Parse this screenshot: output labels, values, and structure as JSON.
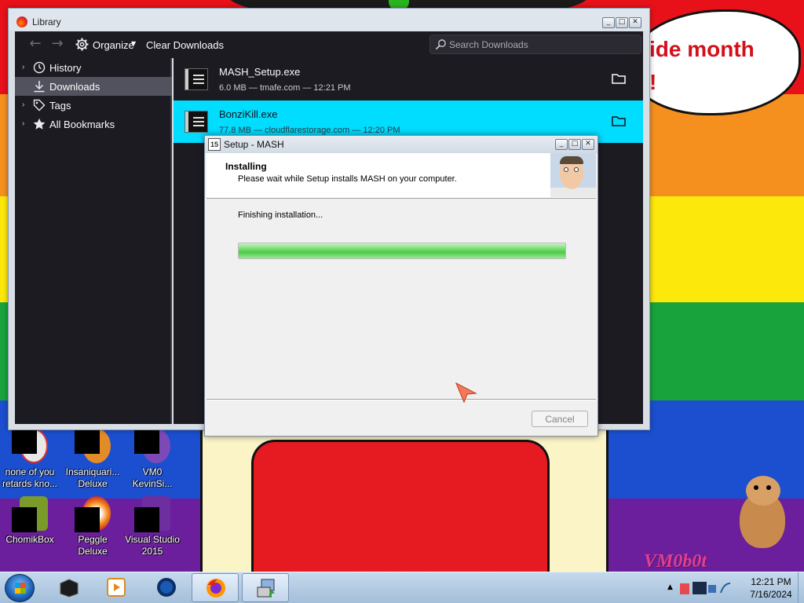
{
  "desktop": {
    "speech_bubble": [
      "ide month",
      "!"
    ],
    "watermark": "VM0b0t",
    "icons": [
      {
        "label": "none of you retards kno..."
      },
      {
        "label": "Insaniquari... Deluxe"
      },
      {
        "label": "VM0 KevinSi..."
      },
      {
        "label": "ChomikBox"
      },
      {
        "label": "Peggle Deluxe"
      },
      {
        "label": "Visual Studio 2015"
      }
    ]
  },
  "library": {
    "title": "Library",
    "toolbar": {
      "organize_label": "Organize",
      "clear_label": "Clear Downloads",
      "search_placeholder": "Search Downloads"
    },
    "sidebar": [
      {
        "label": "History",
        "icon": "clock-icon"
      },
      {
        "label": "Downloads",
        "icon": "download-icon"
      },
      {
        "label": "Tags",
        "icon": "tag-icon"
      },
      {
        "label": "All Bookmarks",
        "icon": "star-icon"
      }
    ],
    "downloads": [
      {
        "name": "MASH_Setup.exe",
        "meta": "6.0 MB — tmafe.com — 12:21 PM"
      },
      {
        "name": "BonziKill.exe",
        "meta": "77.8 MB — cloudflarestorage.com — 12:20 PM"
      }
    ]
  },
  "setup": {
    "title": "Setup - MASH",
    "heading": "Installing",
    "subheading": "Please wait while Setup installs MASH on your computer.",
    "status": "Finishing installation...",
    "progress_percent": 100,
    "cancel_label": "Cancel",
    "title_icon_text": "15"
  },
  "taskbar": {
    "time": "12:21 PM",
    "date": "7/16/2024"
  },
  "colors": {
    "selected_row": "#00ddff",
    "dark_panel": "#1c1b22",
    "progress_green": "#4fc94a"
  }
}
